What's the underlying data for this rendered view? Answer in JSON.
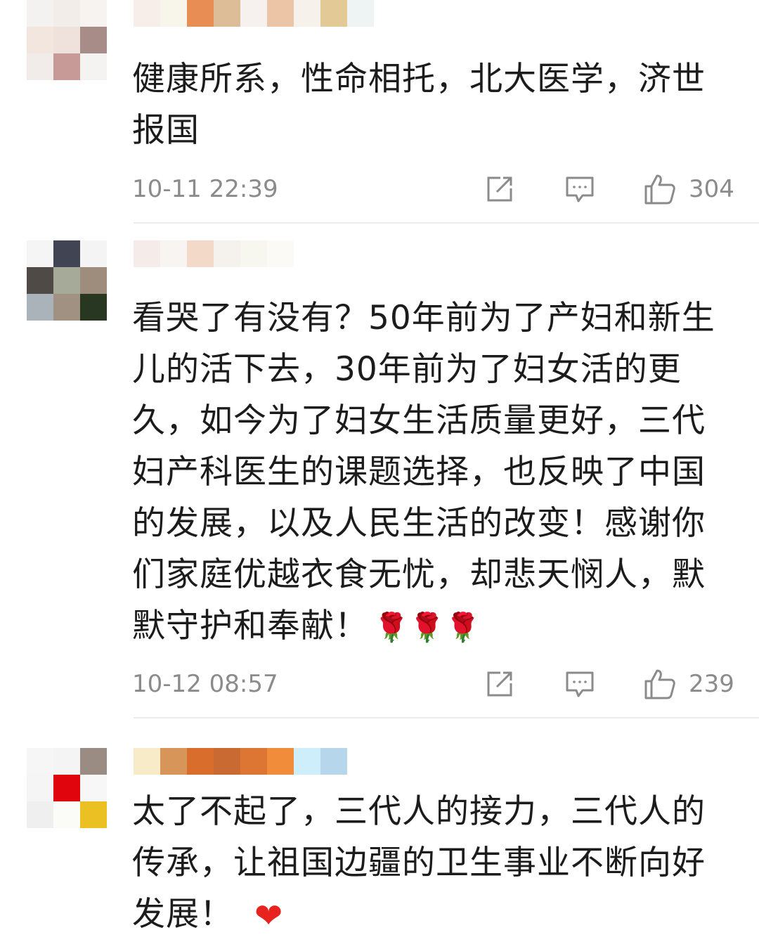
{
  "comments": [
    {
      "avatar_pixels": [
        "#f4f2f0",
        "#f3ede9",
        "#f6f3f1",
        "#f3e6df",
        "#efe2dc",
        "#a88c88",
        "#f1ece9",
        "#c89a97",
        "#f4f3f2"
      ],
      "username_pixels": [
        "#f7ede9",
        "#f8f5ea",
        "#e88e54",
        "#dcbd98",
        "#f6f1ee",
        "#ecc5a6",
        "#f6f1ea",
        "#e2c995",
        "#eef3f4"
      ],
      "text": "健康所系，性命相托，北大医学，济世报国",
      "emoji": "",
      "timestamp": "10-11 22:39",
      "likes": "304"
    },
    {
      "avatar_pixels": [
        "#f5f5f5",
        "#414453",
        "#f4f4f4",
        "#4f4a45",
        "#a5ab98",
        "#9e8c7c",
        "#aab3b9",
        "#a19182",
        "#273721"
      ],
      "username_pixels": [
        "#f5ecea",
        "#f7f4f2",
        "#f2d9c8",
        "#f5f1ec",
        "#f7f6ef",
        "#fbfaf6",
        "#ffffff",
        "#ffffff",
        "#ffffff"
      ],
      "text": "看哭了有没有？50年前为了产妇和新生儿的活下去，30年前为了妇女活的更久，如今为了妇女生活质量更好，三代妇产科医生的课题选择，也反映了中国的发展，以及人民生活的改变！感谢你们家庭优越衣食无忧，却悲天悯人，默默守护和奉献！",
      "emoji": "🌹🌹🌹",
      "timestamp": "10-12 08:57",
      "likes": "239"
    },
    {
      "avatar_pixels": [
        "#f6f6f6",
        "#f4f4f4",
        "#9a8c83",
        "#f5f5f5",
        "#e0040c",
        "#f7f7f7",
        "#efefef",
        "#fbfbf8",
        "#ebc022"
      ],
      "username_pixels": [
        "#f8ecc8",
        "#d7955a",
        "#d96d2c",
        "#c96a33",
        "#dd7632",
        "#f08c3a",
        "#cfeefb",
        "#b6d6ec",
        "#ffffff"
      ],
      "text": "太了不起了，三代人的接力，三代人的传承，让祖国边疆的卫生事业不断向好发展！",
      "emoji": "❤",
      "timestamp": "",
      "likes": ""
    }
  ],
  "colors": {
    "text": "#1c1c1c",
    "meta": "#8b8b8b",
    "divider": "#ececec",
    "heart": "#e8231f"
  },
  "icons": {
    "share": "share-icon",
    "comment": "comment-icon",
    "like": "thumbs-up-icon"
  }
}
